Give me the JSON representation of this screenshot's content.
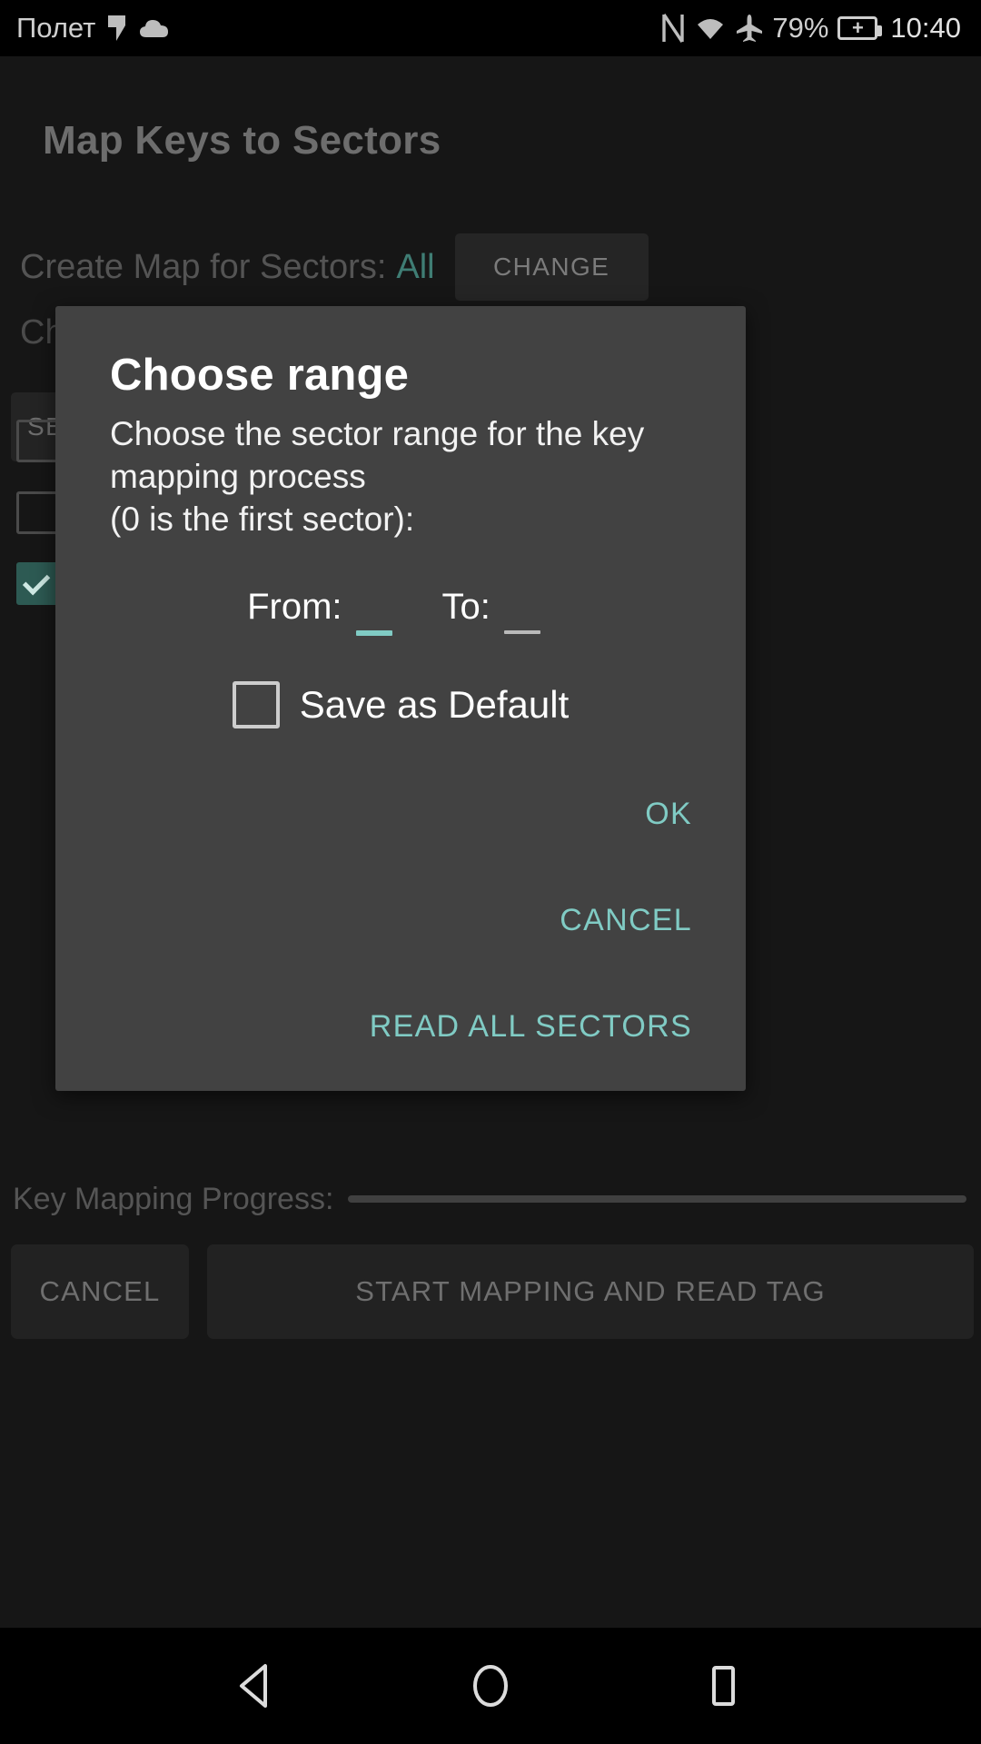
{
  "statusbar": {
    "carrier": "Полет",
    "battery_percent": "79%",
    "clock": "10:40",
    "icons": [
      "location-icon",
      "cloud-icon",
      "nfc-icon",
      "wifi-icon",
      "airplane-icon",
      "battery-charging-icon"
    ]
  },
  "app": {
    "title": "Map Keys to Sectors",
    "sectors_label": "Create Map for Sectors:",
    "sectors_value": "All",
    "change_button": "CHANGE",
    "choose_files_label": "Choose some key file(s):",
    "select_button": "SELECT",
    "file_checkboxes": [
      {
        "checked": false
      },
      {
        "checked": false
      },
      {
        "checked": true
      }
    ],
    "progress_label": "Key Mapping Progress:",
    "progress_percent": 0,
    "cancel_button": "CANCEL",
    "start_button": "START MAPPING AND READ TAG"
  },
  "dialog": {
    "title": "Choose range",
    "message": "Choose the sector range for the key mapping process\n(0 is the first sector):",
    "from_label": "From:",
    "from_value": "",
    "to_label": "To:",
    "to_value": "",
    "save_default_label": "Save as Default",
    "save_default_checked": false,
    "actions": {
      "ok": "OK",
      "cancel": "CANCEL",
      "read_all": "READ ALL SECTORS"
    }
  },
  "navbar": {
    "back": "back-icon",
    "home": "home-icon",
    "recents": "recents-icon"
  },
  "colors": {
    "accent_teal": "#80cbc4",
    "dialog_bg": "#424242",
    "app_bg": "#161616",
    "status_bg": "#000000"
  }
}
